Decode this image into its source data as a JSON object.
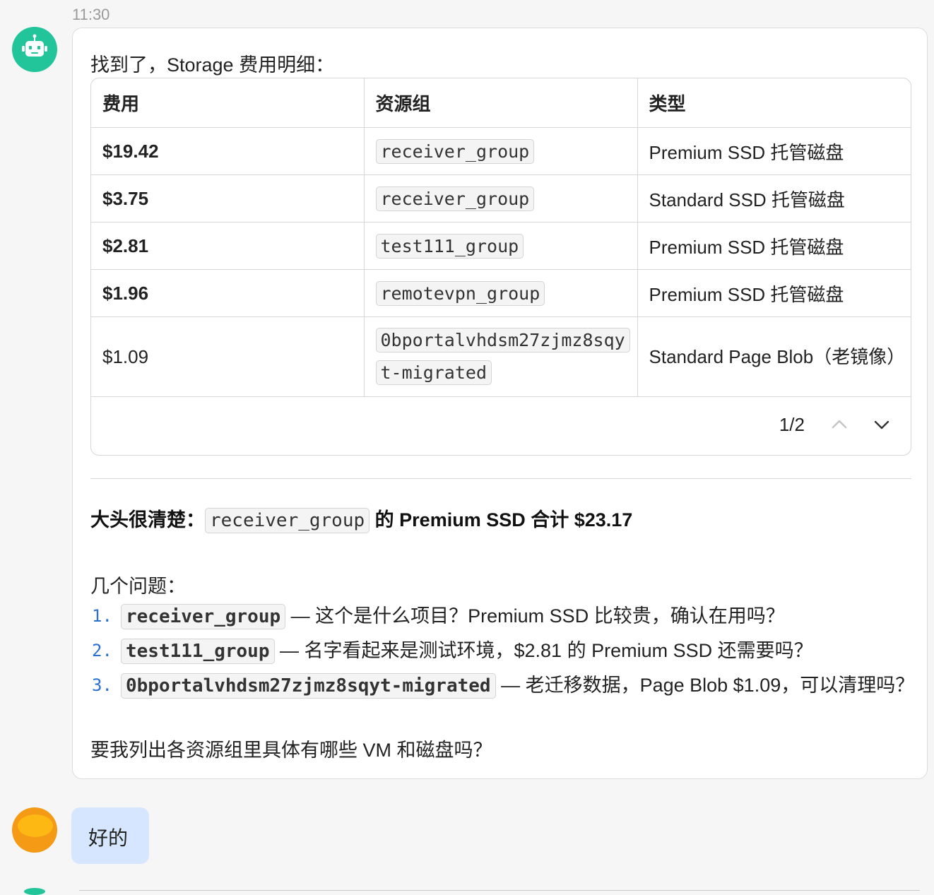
{
  "message_time": "11:30",
  "assistant": {
    "intro": "找到了，Storage 费用明细：",
    "table": {
      "headers": [
        "费用",
        "资源组",
        "类型"
      ],
      "rows": [
        {
          "cost": "$19.42",
          "group": "receiver_group",
          "type": "Premium SSD 托管磁盘"
        },
        {
          "cost": "$3.75",
          "group": "receiver_group",
          "type": "Standard SSD 托管磁盘"
        },
        {
          "cost": "$2.81",
          "group": "test111_group",
          "type": "Premium SSD 托管磁盘"
        },
        {
          "cost": "$1.96",
          "group": "remotevpn_group",
          "type": "Premium SSD 托管磁盘"
        },
        {
          "cost": "$1.09",
          "group": "0bportalvhdsm27zjmz8sqyt-migrated",
          "type": "Standard Page Blob（老镜像）"
        }
      ],
      "pager": "1/2"
    },
    "summary": {
      "prefix": "大头很清楚：",
      "code": "receiver_group",
      "suffix": " 的 Premium SSD 合计 $23.17"
    },
    "questions_title": "几个问题：",
    "questions": [
      {
        "num": "1.",
        "code": "receiver_group",
        "text": " — 这个是什么项目？Premium SSD 比较贵，确认在用吗？"
      },
      {
        "num": "2.",
        "code": "test111_group",
        "text": " — 名字看起来是测试环境，$2.81 的 Premium SSD 还需要吗？"
      },
      {
        "num": "3.",
        "code": "0bportalvhdsm27zjmz8sqyt-migrated",
        "text": " — 老迁移数据，Page Blob $1.09，可以清理吗？"
      }
    ],
    "closing": "要我列出各资源组里具体有哪些 VM 和磁盘吗？"
  },
  "user": {
    "message": "好的"
  },
  "colors": {
    "bot_avatar": "#22c59a",
    "user_avatar": "#f49a14",
    "user_bubble": "#d6e6ff",
    "list_number": "#2a6fd1"
  },
  "icons": [
    "robot-icon",
    "chevron-up-icon",
    "chevron-down-icon"
  ]
}
